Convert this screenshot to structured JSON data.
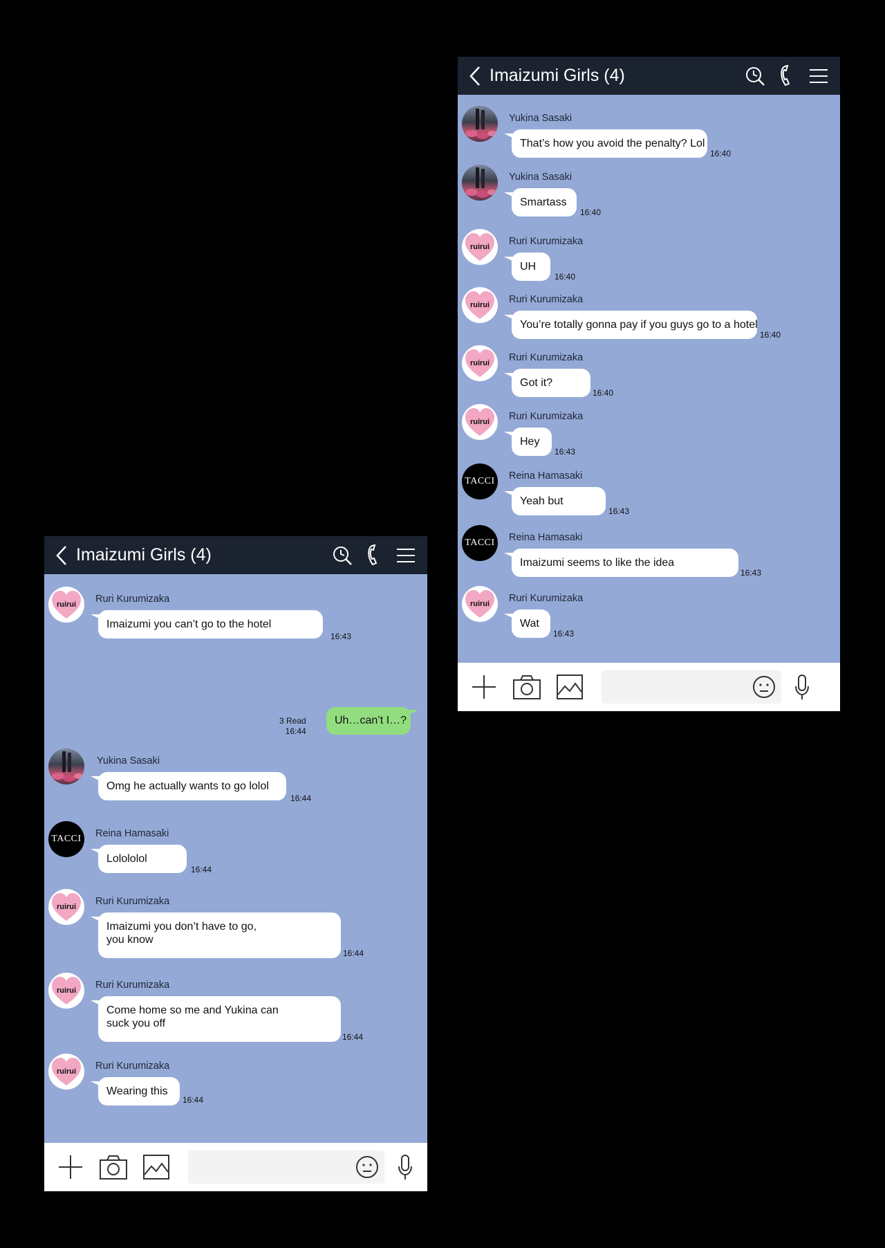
{
  "right_screen": {
    "title": "Imaizumi Girls (4)",
    "messages": [
      {
        "sender": "Yukina Sasaki",
        "avatar": "yukina-photo",
        "text": "That’s how you avoid the penalty? Lol",
        "time": "16:40"
      },
      {
        "sender": "Yukina Sasaki",
        "avatar": "yukina-photo",
        "text": "Smartass",
        "time": "16:40"
      },
      {
        "sender": "Ruri Kurumizaka",
        "avatar": "ruirui-heart",
        "text": "UH",
        "time": "16:40"
      },
      {
        "sender": "Ruri Kurumizaka",
        "avatar": "ruirui-heart",
        "text": "You’re totally gonna pay if you guys go to a hotel",
        "time": "16:40"
      },
      {
        "sender": "Ruri Kurumizaka",
        "avatar": "ruirui-heart",
        "text": "Got it?",
        "time": "16:40"
      },
      {
        "sender": "Ruri Kurumizaka",
        "avatar": "ruirui-heart",
        "text": "Hey",
        "time": "16:43"
      },
      {
        "sender": "Reina Hamasaki",
        "avatar": "tacci",
        "text": "Yeah but",
        "time": "16:43"
      },
      {
        "sender": "Reina Hamasaki",
        "avatar": "tacci",
        "text": "Imaizumi seems to like the idea",
        "time": "16:43"
      },
      {
        "sender": "Ruri Kurumizaka",
        "avatar": "ruirui-heart",
        "text": "Wat",
        "time": "16:43"
      }
    ]
  },
  "left_screen": {
    "title": "Imaizumi Girls (4)",
    "messages": [
      {
        "sender": "Ruri Kurumizaka",
        "avatar": "ruirui-heart",
        "text": "Imaizumi you can’t go to the hotel",
        "time": "16:43"
      },
      {
        "sender": "Yukina Sasaki",
        "avatar": "yukina-photo",
        "text": "Omg he actually wants to go lolol",
        "time": "16:44"
      },
      {
        "sender": "Reina Hamasaki",
        "avatar": "tacci",
        "text": "Lolololol",
        "time": "16:44"
      },
      {
        "sender": "Ruri Kurumizaka",
        "avatar": "ruirui-heart",
        "text_line1": "Imaizumi you don’t have to go,",
        "text_line2": "you know",
        "time": "16:44"
      },
      {
        "sender": "Ruri Kurumizaka",
        "avatar": "ruirui-heart",
        "text_line1": "Come home so me and Yukina can",
        "text_line2": "suck you off",
        "time": "16:44"
      },
      {
        "sender": "Ruri Kurumizaka",
        "avatar": "ruirui-heart",
        "text": "Wearing this",
        "time": "16:44"
      }
    ],
    "sent": {
      "text": "Uh…can’t I…?",
      "read": "3 Read",
      "time": "16:44"
    }
  },
  "avatars": {
    "ruri_label": "ruirui",
    "reina_label": "TACCI"
  },
  "icons": [
    "back-icon",
    "search-clock-icon",
    "phone-icon",
    "menu-icon",
    "plus-icon",
    "camera-icon",
    "image-icon",
    "emoji-icon",
    "mic-icon"
  ],
  "colors": {
    "chat_bg": "#94a9d6",
    "header_bg": "#1b2330",
    "sent_bubble": "#92dd7f",
    "heart": "#f2a7c3"
  }
}
